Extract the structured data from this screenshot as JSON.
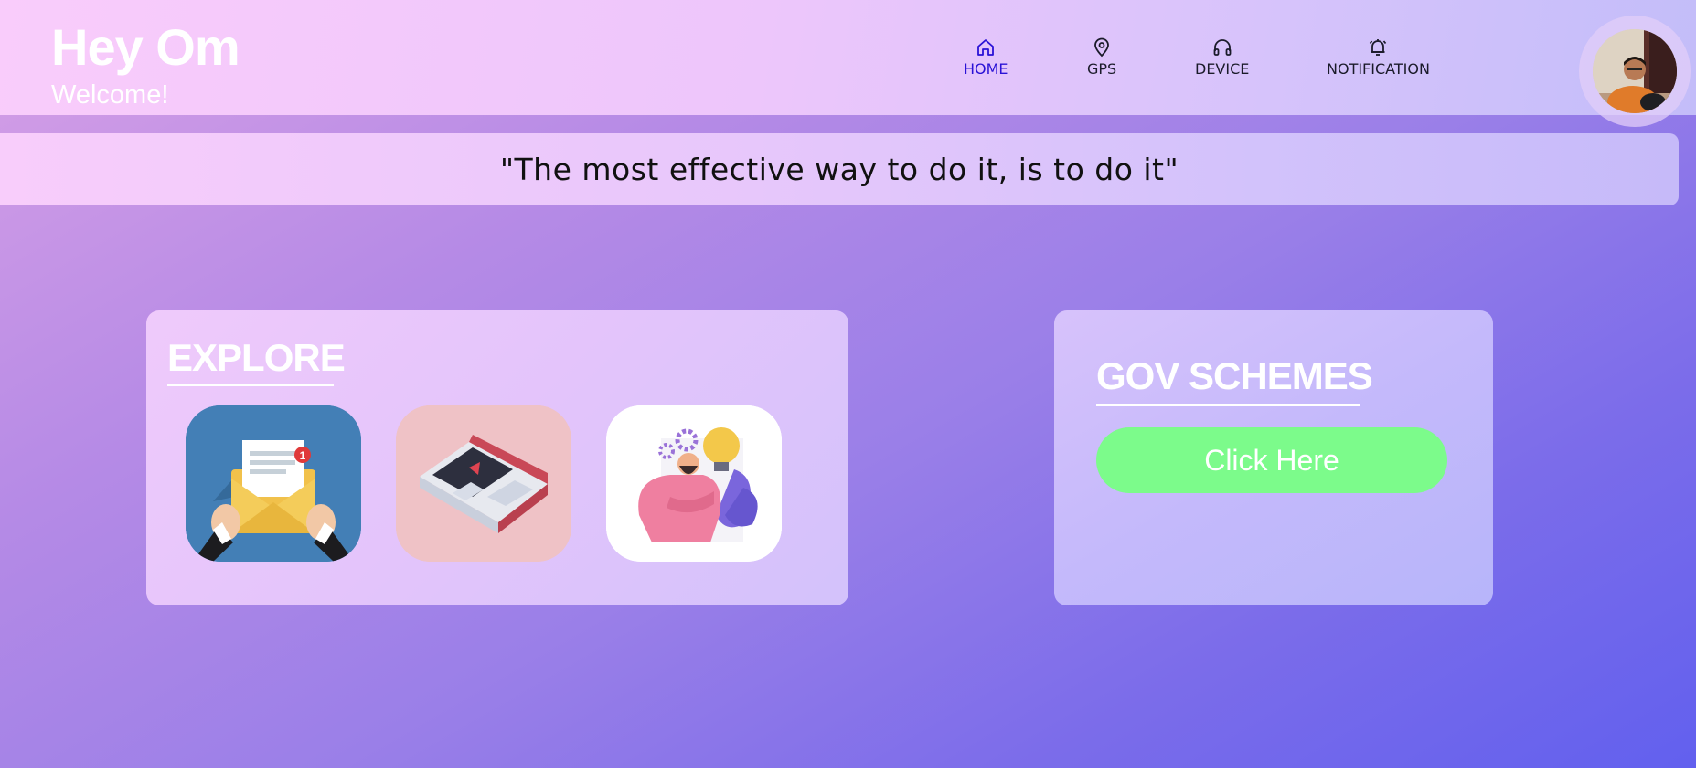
{
  "header": {
    "greeting": "Hey Om",
    "welcome": "Welcome!",
    "nav": [
      {
        "label": "HOME",
        "icon": "home-icon",
        "active": true
      },
      {
        "label": "GPS",
        "icon": "location-pin-icon",
        "active": false
      },
      {
        "label": "DEVICE",
        "icon": "headphones-icon",
        "active": false
      },
      {
        "label": "NOTIFICATION",
        "icon": "alarm-bell-icon",
        "active": false
      }
    ],
    "avatar": "profile-photo"
  },
  "quote": "\"The most effective way to do it, is to do it\"",
  "explore": {
    "title": "EXPLORE",
    "tiles": [
      {
        "icon": "mail-envelope-icon"
      },
      {
        "icon": "video-tablet-icon"
      },
      {
        "icon": "idea-person-icon"
      }
    ]
  },
  "gov_schemes": {
    "title": "GOV SCHEMES",
    "button_label": "Click Here"
  },
  "colors": {
    "active_nav": "#2a12d6",
    "button_green": "#7cfb8b",
    "card_title": "#ffffff"
  }
}
